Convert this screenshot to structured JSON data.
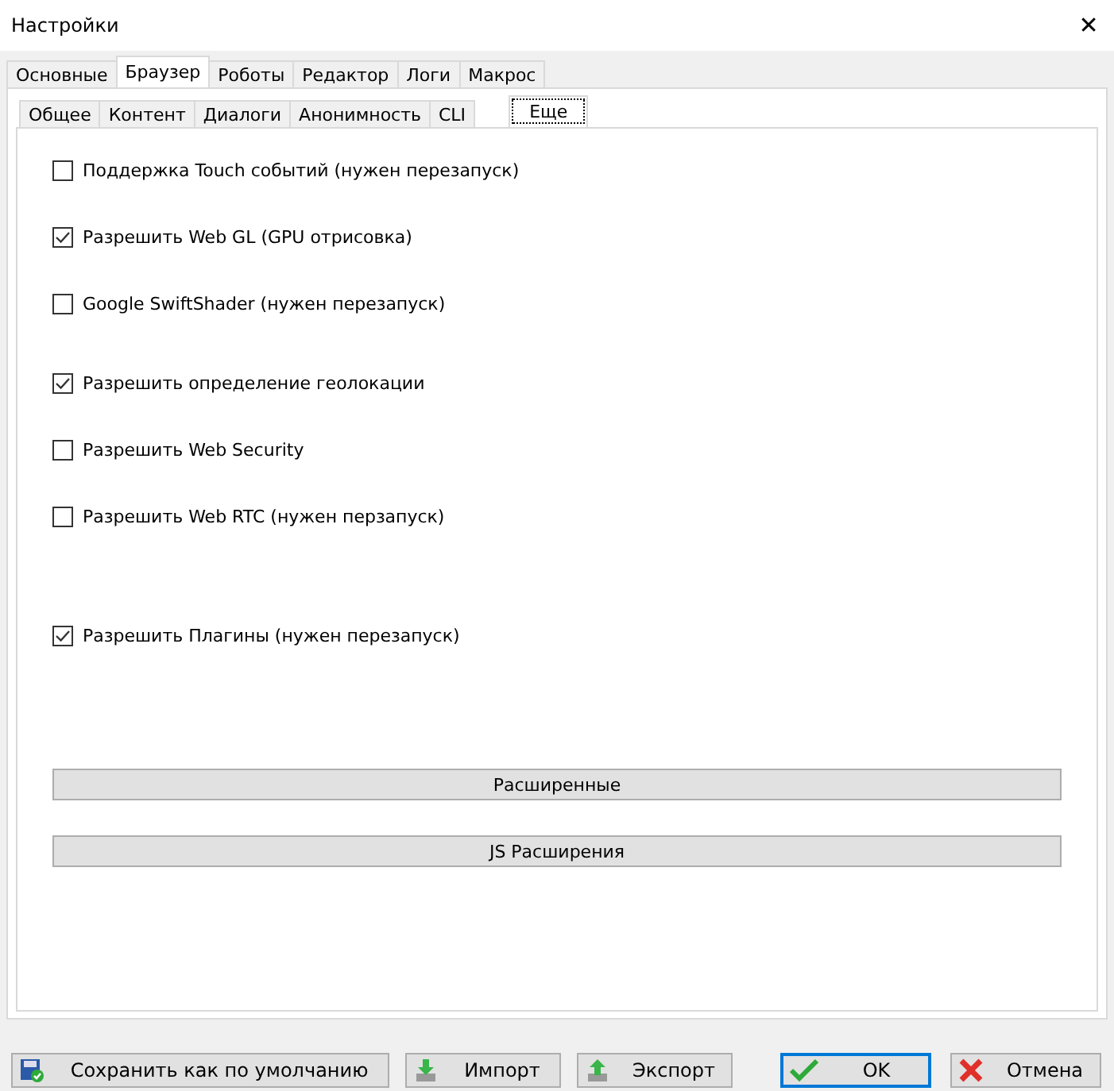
{
  "window": {
    "title": "Настройки",
    "close": "✕"
  },
  "tabs": [
    {
      "label": "Основные",
      "selected": false
    },
    {
      "label": "Браузер",
      "selected": true
    },
    {
      "label": "Роботы",
      "selected": false
    },
    {
      "label": "Редактор",
      "selected": false
    },
    {
      "label": "Логи",
      "selected": false
    },
    {
      "label": "Макрос",
      "selected": false
    }
  ],
  "subtabs": [
    {
      "label": "Общее",
      "selected": false
    },
    {
      "label": "Контент",
      "selected": false
    },
    {
      "label": "Диалоги",
      "selected": false
    },
    {
      "label": "Анонимность",
      "selected": false
    },
    {
      "label": "CLI",
      "selected": false
    },
    {
      "label": "Еще",
      "selected": true
    }
  ],
  "options": [
    {
      "label": "Поддержка Touch событий (нужен перезапуск)",
      "checked": false
    },
    {
      "label": "Разрешить Web GL (GPU отрисовка)",
      "checked": true
    },
    {
      "label": "Google SwiftShader (нужен перезапуск)",
      "checked": false
    },
    {
      "label": "Разрешить определение геолокации",
      "checked": true
    },
    {
      "label": "Разрешить Web Security",
      "checked": false
    },
    {
      "label": "Разрешить  Web RTC (нужен перзапуск)",
      "checked": false
    },
    {
      "label": "Разрешить Плагины (нужен перезапуск)",
      "checked": true
    }
  ],
  "panel_buttons": [
    "Расширенные",
    "JS Расширения"
  ],
  "footer_buttons": [
    {
      "label": "Сохранить как по умолчанию",
      "kind": "save",
      "default": false
    },
    {
      "label": "Импорт",
      "kind": "import",
      "default": false
    },
    {
      "label": "Экспорт",
      "kind": "export",
      "default": false
    },
    {
      "label": "OK",
      "kind": "ok",
      "default": true
    },
    {
      "label": "Отмена",
      "kind": "cancel",
      "default": false
    }
  ]
}
